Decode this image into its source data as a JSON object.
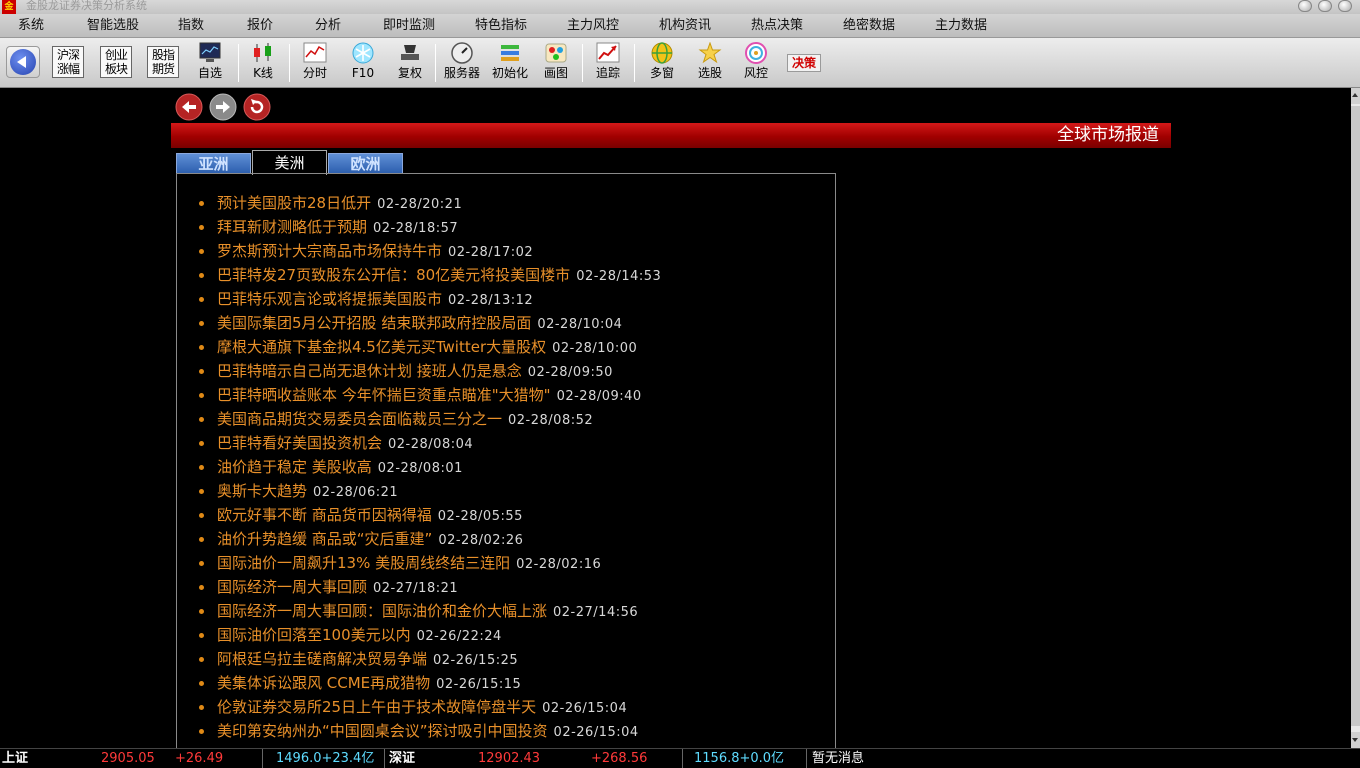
{
  "app": {
    "logo": "金",
    "title": "金股龙证券决策分析系统"
  },
  "menu": [
    "系统",
    "智能选股",
    "指数",
    "报价",
    "分析",
    "即时监测",
    "特色指标",
    "主力风控",
    "机构资讯",
    "热点决策",
    "绝密数据",
    "主力数据"
  ],
  "toolbar": {
    "text_buttons": [
      "沪深涨幅",
      "创业板块",
      "股指期货"
    ],
    "buttons": [
      {
        "label": "自选",
        "icon": "monitor-icon"
      },
      {
        "label": "K线",
        "icon": "candlestick-icon"
      },
      {
        "label": "分时",
        "icon": "line-chart-icon"
      },
      {
        "label": "F10",
        "icon": "snowflake-icon"
      },
      {
        "label": "复权",
        "icon": "stamp-icon"
      },
      {
        "label": "服务器",
        "icon": "gauge-icon"
      },
      {
        "label": "初始化",
        "icon": "layers-icon"
      },
      {
        "label": "画图",
        "icon": "paint-icon"
      },
      {
        "label": "追踪",
        "icon": "trend-icon"
      },
      {
        "label": "多窗",
        "icon": "globe-icon"
      },
      {
        "label": "选股",
        "icon": "star-burst-icon"
      },
      {
        "label": "风控",
        "icon": "target-icon"
      }
    ],
    "decision_label": "决策"
  },
  "banner": {
    "title": "全球市场报道"
  },
  "tabs": [
    {
      "label": "亚洲",
      "active": false
    },
    {
      "label": "美洲",
      "active": true
    },
    {
      "label": "欧洲",
      "active": false
    }
  ],
  "news": [
    {
      "headline": "预计美国股市28日低开",
      "time": "02-28/20:21"
    },
    {
      "headline": "拜耳新财测略低于预期",
      "time": "02-28/18:57"
    },
    {
      "headline": "罗杰斯预计大宗商品市场保持牛市",
      "time": "02-28/17:02"
    },
    {
      "headline": "巴菲特发27页致股东公开信：80亿美元将投美国楼市",
      "time": "02-28/14:53"
    },
    {
      "headline": "巴菲特乐观言论或将提振美国股市",
      "time": "02-28/13:12"
    },
    {
      "headline": "美国际集团5月公开招股 结束联邦政府控股局面",
      "time": "02-28/10:04"
    },
    {
      "headline": "摩根大通旗下基金拟4.5亿美元买Twitter大量股权",
      "time": "02-28/10:00"
    },
    {
      "headline": "巴菲特暗示自己尚无退休计划 接班人仍是悬念",
      "time": "02-28/09:50"
    },
    {
      "headline": "巴菲特晒收益账本 今年怀揣巨资重点瞄准\"大猎物\"",
      "time": "02-28/09:40"
    },
    {
      "headline": "美国商品期货交易委员会面临裁员三分之一",
      "time": "02-28/08:52"
    },
    {
      "headline": "巴菲特看好美国投资机会",
      "time": "02-28/08:04"
    },
    {
      "headline": "油价趋于稳定 美股收高",
      "time": "02-28/08:01"
    },
    {
      "headline": "奥斯卡大趋势",
      "time": "02-28/06:21"
    },
    {
      "headline": "欧元好事不断 商品货币因祸得福",
      "time": "02-28/05:55"
    },
    {
      "headline": "油价升势趋缓 商品或“灾后重建”",
      "time": "02-28/02:26"
    },
    {
      "headline": "国际油价一周飙升13% 美股周线终结三连阳",
      "time": "02-28/02:16"
    },
    {
      "headline": "国际经济一周大事回顾",
      "time": "02-27/18:21"
    },
    {
      "headline": "国际经济一周大事回顾：国际油价和金价大幅上涨",
      "time": "02-27/14:56"
    },
    {
      "headline": "国际油价回落至100美元以内",
      "time": "02-26/22:24"
    },
    {
      "headline": "阿根廷乌拉圭磋商解决贸易争端",
      "time": "02-26/15:25"
    },
    {
      "headline": "美集体诉讼跟风 CCME再成猎物",
      "time": "02-26/15:15"
    },
    {
      "headline": "伦敦证券交易所25日上午由于技术故障停盘半天",
      "time": "02-26/15:04"
    },
    {
      "headline": "美印第安纳州办“中国圆桌会议”探讨吸引中国投资",
      "time": "02-26/15:04"
    }
  ],
  "statusbar": {
    "sh_label": "上证",
    "sh_index": "2905.05",
    "sh_change": "+26.49",
    "sh_volume": "1496.0+23.4亿",
    "sz_label": "深证",
    "sz_index": "12902.43",
    "sz_change": "+268.56",
    "sz_volume": "1156.8+0.0亿",
    "message": "暂无消息"
  },
  "colors": {
    "headline": "#e8902a",
    "banner": "#b00000",
    "tab_inactive": "#2d5fae",
    "status_red": "#ff3a3a",
    "status_cyan": "#5fdcff"
  }
}
